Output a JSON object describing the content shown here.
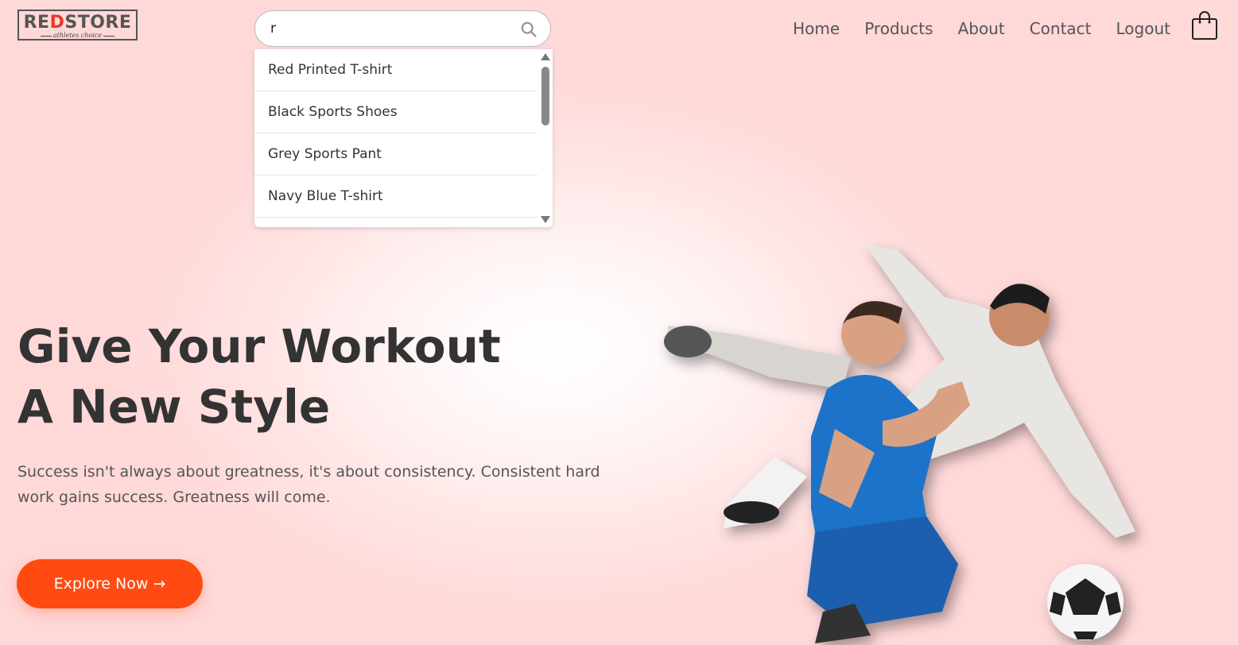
{
  "logo": {
    "brand_part1": "RE",
    "brand_accent": "D",
    "brand_part2": "STORE",
    "tagline": "athletes choice"
  },
  "search": {
    "value": "r",
    "suggestions": [
      "Red Printed T-shirt",
      "Black Sports Shoes",
      "Grey Sports Pant",
      "Navy Blue T-shirt"
    ]
  },
  "nav": {
    "items": [
      "Home",
      "Products",
      "About",
      "Contact",
      "Logout"
    ]
  },
  "hero": {
    "title_line1": "Give Your Workout",
    "title_line2": "A New Style",
    "text": "Success isn't always about greatness, it's about consistency. Consistent hard work gains success. Greatness will come.",
    "button_label": "Explore Now →"
  },
  "icons": {
    "search": "search-icon",
    "cart": "shopping-bag-icon"
  },
  "colors": {
    "accent": "#ff4b12",
    "logo_red": "#e7392b"
  }
}
